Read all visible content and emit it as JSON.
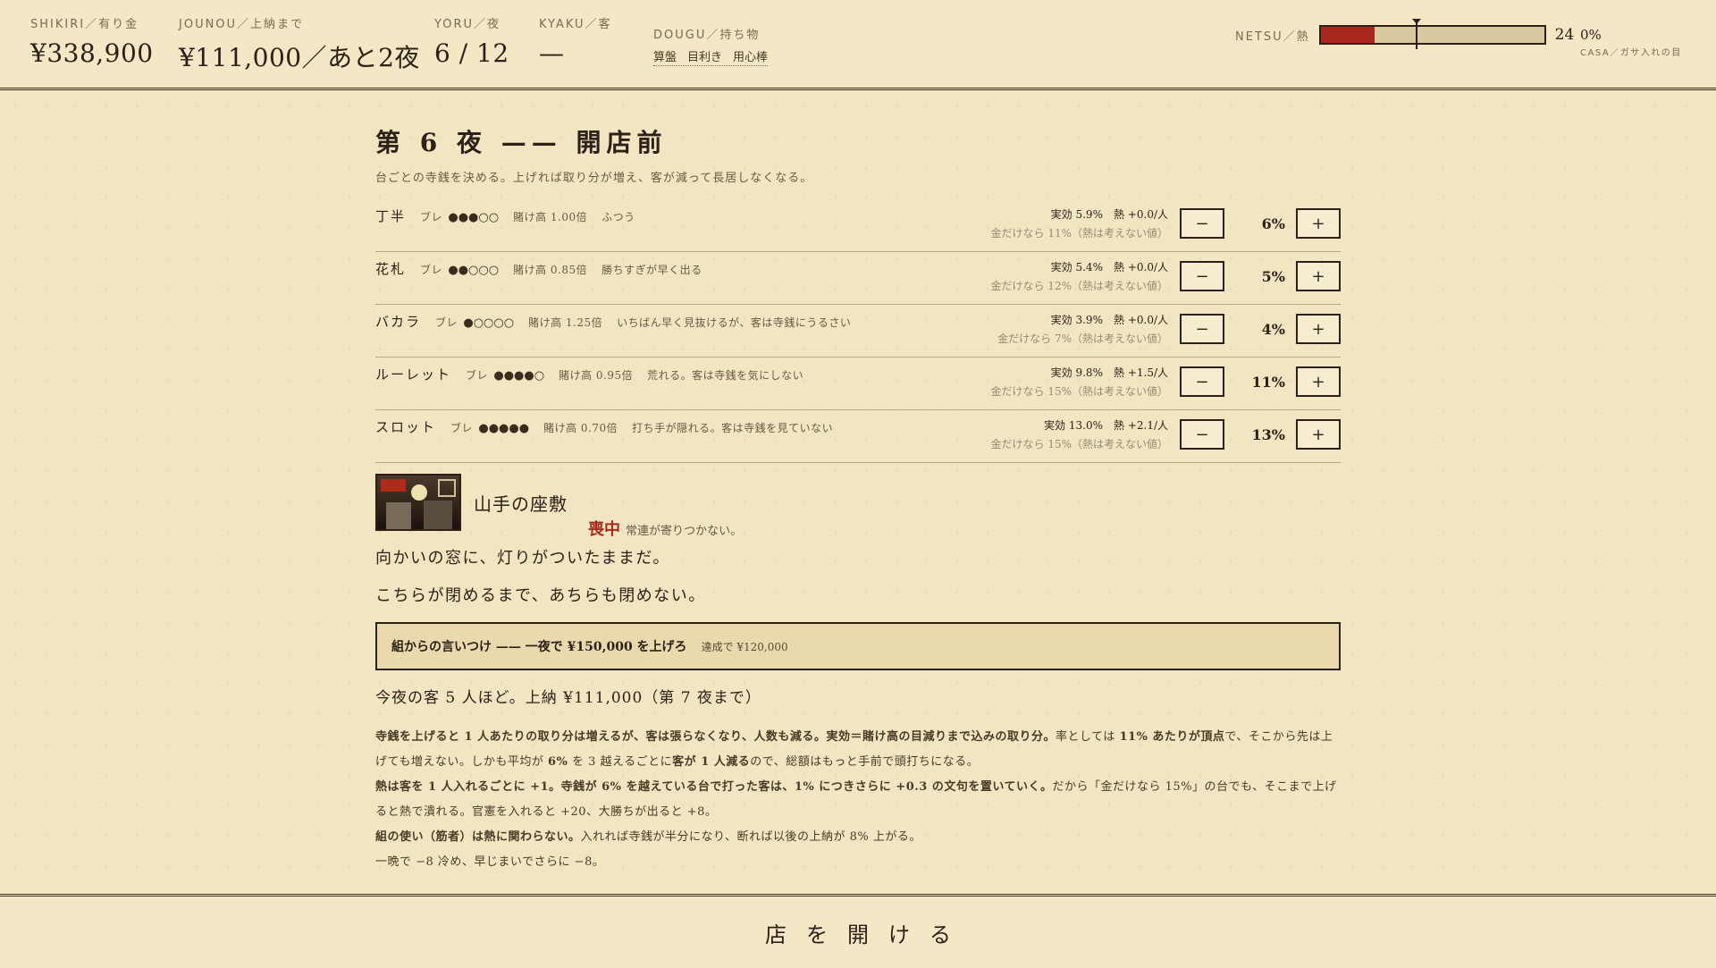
{
  "topbar": {
    "shikiri": {
      "label": "SHIKIRI／有り金",
      "value": "¥338,900"
    },
    "jounou": {
      "label": "JOUNOU／上納まで",
      "value": "¥111,000／あと2夜"
    },
    "yoru": {
      "label": "YORU／夜",
      "value": "6 / 12"
    },
    "kyaku": {
      "label": "KYAKU／客",
      "value": "—"
    },
    "dougu": {
      "label": "DOUGU／持ち物",
      "items": [
        "算盤",
        "目利き",
        "用心棒"
      ]
    },
    "netsu": {
      "label": "NETSU／熱",
      "value": "24",
      "fill_fraction": 0.24,
      "marker_fraction": 0.43,
      "fill_color": "#a82a1c"
    },
    "casa": {
      "value": "0%",
      "label": "CASA／ガサ入れの目"
    }
  },
  "night": {
    "title": "第 6 夜 —— 開店前",
    "subtitle": "台ごとの寺銭を決める。上げれば取り分が増え、客が減って長居しなくなる。"
  },
  "games": [
    {
      "name": "丁半",
      "bure_label": "ブレ",
      "dots": "●●●○○",
      "kakedaka": "賭け高 1.00倍",
      "note": "ふつう",
      "effective": "実効 5.9%",
      "heat": "熱 +0.0/人",
      "money_only": "金だけなら 11%（熱は考えない値）",
      "percent": "6%"
    },
    {
      "name": "花札",
      "bure_label": "ブレ",
      "dots": "●●○○○",
      "kakedaka": "賭け高 0.85倍",
      "note": "勝ちすぎが早く出る",
      "effective": "実効 5.4%",
      "heat": "熱 +0.0/人",
      "money_only": "金だけなら 12%（熱は考えない値）",
      "percent": "5%"
    },
    {
      "name": "バカラ",
      "bure_label": "ブレ",
      "dots": "●○○○○",
      "kakedaka": "賭け高 1.25倍",
      "note": "いちばん早く見抜けるが、客は寺銭にうるさい",
      "effective": "実効 3.9%",
      "heat": "熱 +0.0/人",
      "money_only": "金だけなら 7%（熱は考えない値）",
      "percent": "4%"
    },
    {
      "name": "ルーレット",
      "bure_label": "ブレ",
      "dots": "●●●●○",
      "kakedaka": "賭け高 0.95倍",
      "note": "荒れる。客は寺銭を気にしない",
      "effective": "実効 9.8%",
      "heat": "熱 +1.5/人",
      "money_only": "金だけなら 15%（熱は考えない値）",
      "percent": "11%"
    },
    {
      "name": "スロット",
      "bure_label": "ブレ",
      "dots": "●●●●●",
      "kakedaka": "賭け高 0.70倍",
      "note": "打ち手が隠れる。客は寺銭を見ていない",
      "effective": "実効 13.0%",
      "heat": "熱 +2.1/人",
      "money_only": "金だけなら 15%（熱は考えない値）",
      "percent": "13%"
    }
  ],
  "controls": {
    "minus": "−",
    "plus": "+"
  },
  "venue": {
    "name": "山手の座敷",
    "status": "喪中",
    "status_note": "常連が寄りつかない。"
  },
  "story": [
    "向かいの窓に、灯りがついたままだ。",
    "こちらが閉めるまで、あちらも閉めない。"
  ],
  "order": {
    "bold": "組からの言いつけ",
    "text": " —— 一夜で ¥150,000 を上げろ",
    "goal": "達成で ¥120,000"
  },
  "tonight": "今夜の客 5 人ほど。上納 ¥111,000（第 7 夜まで）",
  "notes": [
    [
      {
        "t": "寺銭を上げると 1 人あたりの取り分は増えるが、客は張らなくなり、人数も減る。",
        "b": true
      },
      {
        "t": "実効＝賭け高の目減りまで込みの取り分。",
        "b": true
      },
      {
        "t": "率としては ",
        "b": false
      },
      {
        "t": "11% あたりが頂点",
        "b": true
      },
      {
        "t": "で、そこから先は上げても増えない。しかも平均が ",
        "b": false
      },
      {
        "t": "6%",
        "b": true
      },
      {
        "t": " を 3 越えるごとに",
        "b": false
      },
      {
        "t": "客が 1 人減る",
        "b": true
      },
      {
        "t": "ので、総額はもっと手前で頭打ちになる。",
        "b": false
      }
    ],
    [
      {
        "t": "熱は客を 1 人入れるごとに +1。",
        "b": true
      },
      {
        "t": "寺銭が 6% を越えている台で打った客は、1% につきさらに +0.3 の文句を置いていく。",
        "b": true
      },
      {
        "t": "だから「金だけなら 15%」の台でも、そこまで上げると熱で潰れる。官憲を入れると +20、大勝ちが出ると +8。",
        "b": false
      }
    ],
    [
      {
        "t": "組の使い（筋者）は熱に関わらない。",
        "b": true
      },
      {
        "t": "入れれば寺銭が半分になり、断れば以後の上納が 8% 上がる。",
        "b": false
      }
    ],
    [
      {
        "t": "一晩で −8 冷め、早じまいでさらに −8。",
        "b": false
      }
    ]
  ],
  "footer": {
    "open_button": "店を開ける"
  }
}
